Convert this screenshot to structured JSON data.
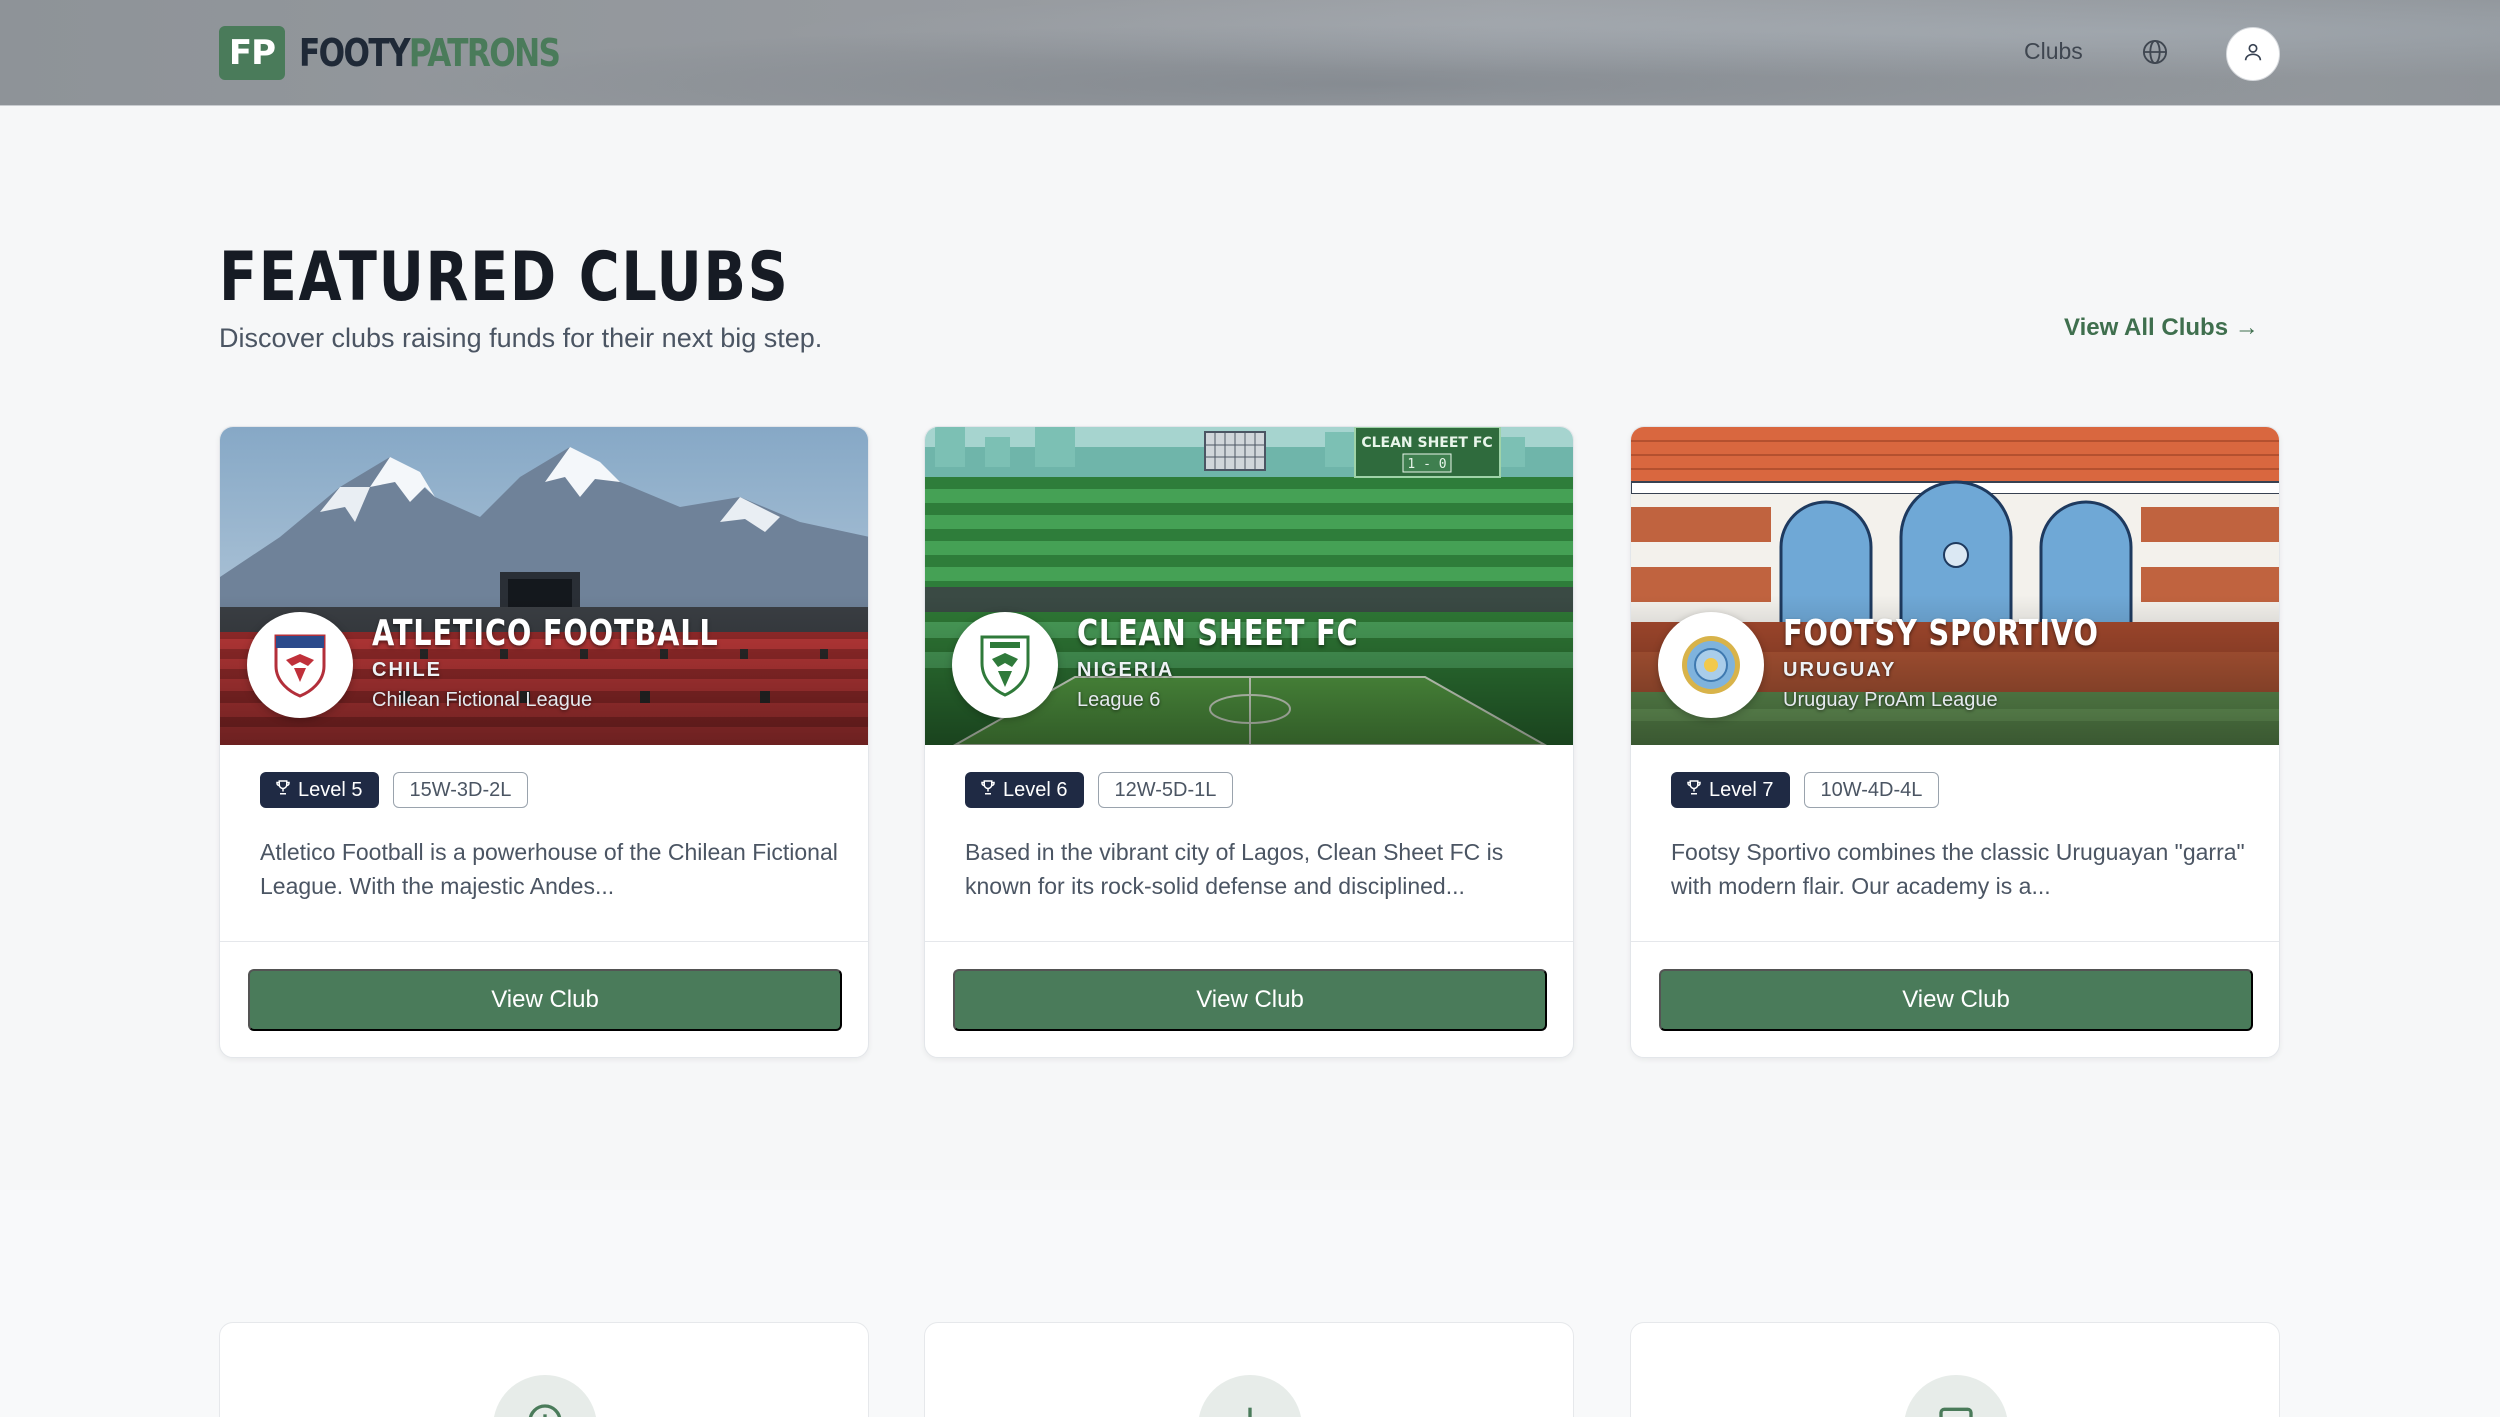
{
  "header": {
    "logo_mark": "FP",
    "logo_text_a": "FOOTY",
    "logo_text_b": "PATRONS",
    "nav_clubs": "Clubs"
  },
  "featured": {
    "title": "FEATURED CLUBS",
    "subtitle": "Discover clubs raising funds for their next big step.",
    "view_all": "View All Clubs →"
  },
  "clubs": [
    {
      "name": "ATLETICO FOOTBALL",
      "country": "CHILE",
      "league": "Chilean Fictional League",
      "level": "Level 5",
      "record": "15W-3D-2L",
      "description": "Atletico Football is a powerhouse of the Chilean Fictional League. With the majestic Andes...",
      "button": "View Club"
    },
    {
      "name": "CLEAN SHEET FC",
      "country": "NIGERIA",
      "league": "League 6",
      "level": "Level 6",
      "record": "12W-5D-1L",
      "description": "Based in the vibrant city of Lagos, Clean Sheet FC is known for its rock-solid defense and disciplined...",
      "button": "View Club",
      "scoreboard_title": "CLEAN SHEET FC",
      "scoreboard_score": "1 - 0"
    },
    {
      "name": "FOOTSY SPORTIVO",
      "country": "URUGUAY",
      "league": "Uruguay ProAm League",
      "level": "Level 7",
      "record": "10W-4D-4L",
      "description": "Footsy Sportivo combines the classic Uruguayan \"garra\" with modern flair. Our academy is a...",
      "button": "View Club"
    }
  ],
  "icons": {
    "globe": "globe-icon",
    "user": "user-icon",
    "trophy": "trophy-icon"
  },
  "colors": {
    "brand_green": "#4a7b5a",
    "level_badge": "#1f2a44",
    "title": "#161b24"
  }
}
